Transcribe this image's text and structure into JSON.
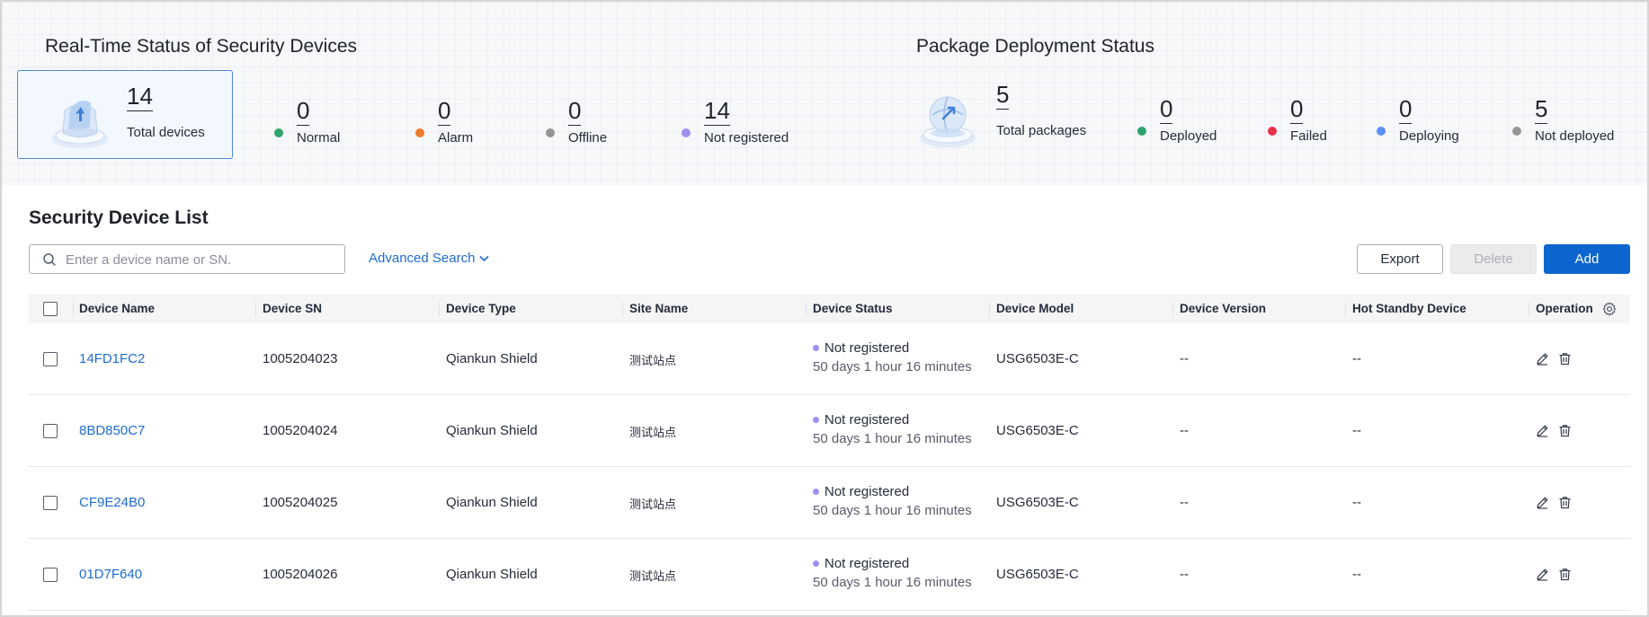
{
  "realtime": {
    "title": "Real-Time Status of Security Devices",
    "total": {
      "value": "14",
      "label": "Total devices"
    },
    "stats": [
      {
        "key": "normal",
        "value": "0",
        "label": "Normal",
        "color": "#2ea36b"
      },
      {
        "key": "alarm",
        "value": "0",
        "label": "Alarm",
        "color": "#ee7a2d"
      },
      {
        "key": "offline",
        "value": "0",
        "label": "Offline",
        "color": "#959595"
      },
      {
        "key": "not-registered",
        "value": "14",
        "label": "Not registered",
        "color": "#a08ff0"
      }
    ]
  },
  "packages": {
    "title": "Package Deployment Status",
    "total": {
      "value": "5",
      "label": "Total packages"
    },
    "stats": [
      {
        "key": "deployed",
        "value": "0",
        "label": "Deployed",
        "color": "#2ea36b"
      },
      {
        "key": "failed",
        "value": "0",
        "label": "Failed",
        "color": "#e8334b"
      },
      {
        "key": "deploying",
        "value": "0",
        "label": "Deploying",
        "color": "#5b8ff9"
      },
      {
        "key": "not-deployed",
        "value": "5",
        "label": "Not deployed",
        "color": "#959595"
      }
    ]
  },
  "list": {
    "title": "Security Device List",
    "search_placeholder": "Enter a device name or SN.",
    "advanced_search": "Advanced Search",
    "export_label": "Export",
    "delete_label": "Delete",
    "add_label": "Add",
    "columns": [
      "Device Name",
      "Device SN",
      "Device Type",
      "Site Name",
      "Device Status",
      "Device Model",
      "Device Version",
      "Hot Standby Device",
      "Operation"
    ],
    "rows": [
      {
        "name": "14FD1FC2",
        "sn": "1005204023",
        "type": "Qiankun Shield",
        "site": "测试站点",
        "status": "Not registered",
        "duration": "50 days 1 hour 16 minutes",
        "model": "USG6503E-C",
        "version": "--",
        "standby": "--"
      },
      {
        "name": "8BD850C7",
        "sn": "1005204024",
        "type": "Qiankun Shield",
        "site": "测试站点",
        "status": "Not registered",
        "duration": "50 days 1 hour 16 minutes",
        "model": "USG6503E-C",
        "version": "--",
        "standby": "--"
      },
      {
        "name": "CF9E24B0",
        "sn": "1005204025",
        "type": "Qiankun Shield",
        "site": "测试站点",
        "status": "Not registered",
        "duration": "50 days 1 hour 16 minutes",
        "model": "USG6503E-C",
        "version": "--",
        "standby": "--"
      },
      {
        "name": "01D7F640",
        "sn": "1005204026",
        "type": "Qiankun Shield",
        "site": "测试站点",
        "status": "Not registered",
        "duration": "50 days 1 hour 16 minutes",
        "model": "USG6503E-C",
        "version": "--",
        "standby": "--"
      }
    ],
    "status_color": "#a08ff0"
  },
  "icons": {
    "search": "search-icon",
    "chevron": "chevron-down-icon",
    "settings": "gear-icon",
    "edit": "edit-icon",
    "delete": "trash-icon"
  }
}
